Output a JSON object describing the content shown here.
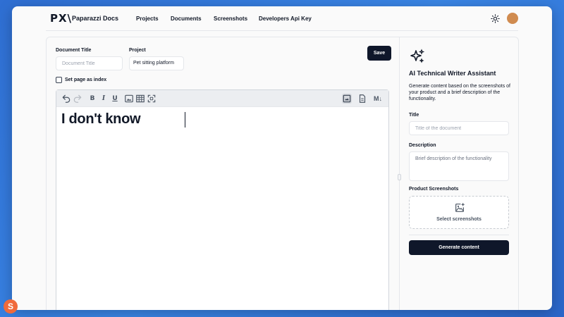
{
  "app": {
    "logo": "PX\\",
    "brand": "Paparazzi Docs"
  },
  "nav": {
    "items": [
      "Projects",
      "Documents",
      "Screenshots",
      "Developers Api Key"
    ]
  },
  "form": {
    "doc_title_label": "Document Title",
    "doc_title_placeholder": "Document Title",
    "project_label": "Project",
    "project_value": "Pet sitting platform",
    "save_label": "Save",
    "index_label": "Set page as index"
  },
  "editor": {
    "content": "I don't know",
    "toolbar_icons": [
      "undo-icon",
      "redo-icon",
      "bold-icon",
      "italic-icon",
      "underline-icon",
      "image-icon",
      "table-icon",
      "fullscreen-icon",
      "wysiwyg-icon",
      "file-icon",
      "markdown-icon"
    ],
    "md_label": "M↓"
  },
  "assistant": {
    "title": "AI Technical Writer Assistant",
    "description": "Generate content based on the screenshots of your product and a brief description of the functionality.",
    "title_label": "Title",
    "title_placeholder": "Title of the document",
    "description_label": "Description",
    "description_placeholder": "Brief description of the functionality",
    "screenshots_label": "Product Screenshots",
    "select_label": "Select screenshots",
    "generate_label": "Generate content"
  },
  "colors": {
    "accent": "#0f172a",
    "avatar": "#d08b4f",
    "background": "#3a86e6"
  }
}
